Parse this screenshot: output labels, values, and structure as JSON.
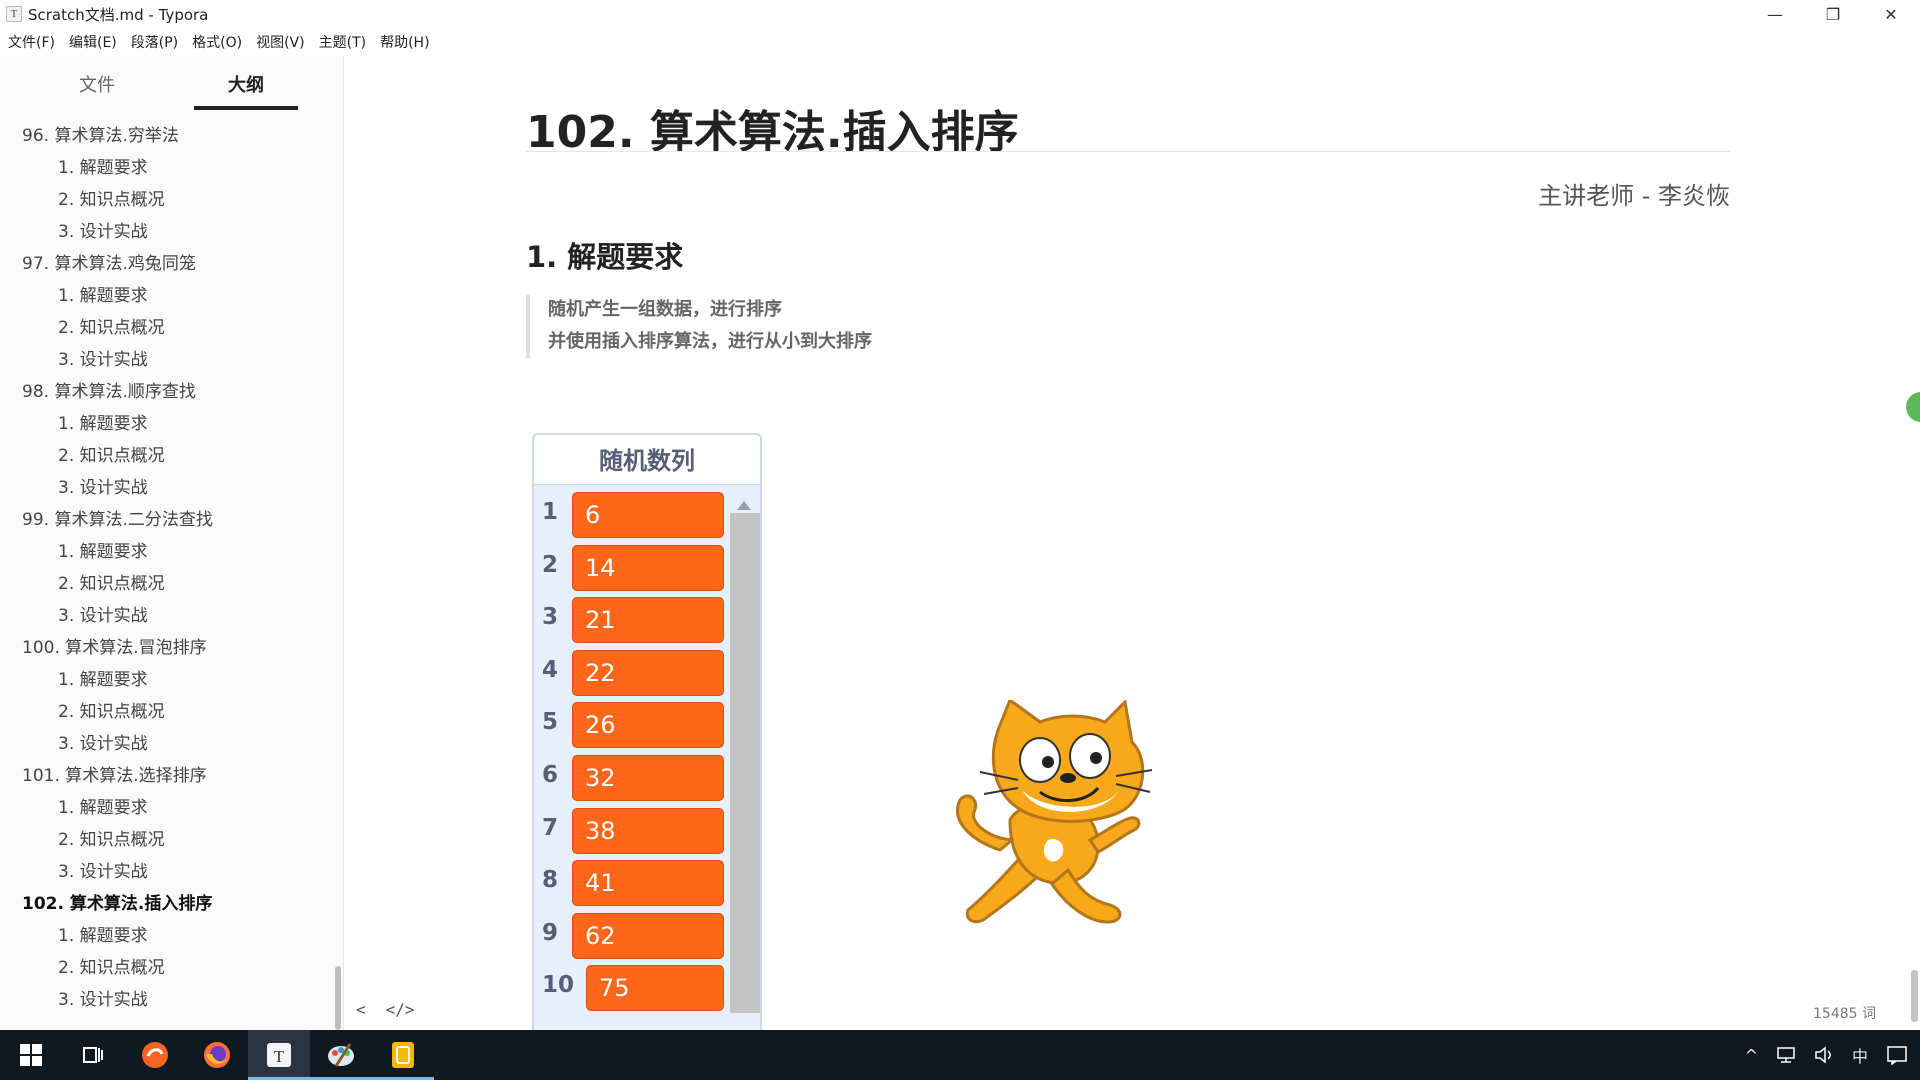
{
  "window": {
    "title": "Scratch文档.md - Typora",
    "app_icon": "T",
    "minimize_glyph": "—",
    "maximize_glyph": "❐",
    "close_glyph": "✕"
  },
  "menu": [
    "文件(F)",
    "编辑(E)",
    "段落(P)",
    "格式(O)",
    "视图(V)",
    "主题(T)",
    "帮助(H)"
  ],
  "sidebar": {
    "tabs": [
      "文件",
      "大纲"
    ],
    "active_tab": "大纲",
    "outline": [
      {
        "text": "96. 算术算法.穷举法",
        "level": 1
      },
      {
        "text": "1. 解题要求",
        "level": 2
      },
      {
        "text": "2. 知识点概况",
        "level": 2
      },
      {
        "text": "3. 设计实战",
        "level": 2
      },
      {
        "text": "97. 算术算法.鸡兔同笼",
        "level": 1
      },
      {
        "text": "1. 解题要求",
        "level": 2
      },
      {
        "text": "2. 知识点概况",
        "level": 2
      },
      {
        "text": "3. 设计实战",
        "level": 2
      },
      {
        "text": "98. 算术算法.顺序查找",
        "level": 1
      },
      {
        "text": "1. 解题要求",
        "level": 2
      },
      {
        "text": "2. 知识点概况",
        "level": 2
      },
      {
        "text": "3. 设计实战",
        "level": 2
      },
      {
        "text": "99. 算术算法.二分法查找",
        "level": 1
      },
      {
        "text": "1. 解题要求",
        "level": 2
      },
      {
        "text": "2. 知识点概况",
        "level": 2
      },
      {
        "text": "3. 设计实战",
        "level": 2
      },
      {
        "text": "100. 算术算法.冒泡排序",
        "level": 1
      },
      {
        "text": "1. 解题要求",
        "level": 2
      },
      {
        "text": "2. 知识点概况",
        "level": 2
      },
      {
        "text": "3. 设计实战",
        "level": 2
      },
      {
        "text": "101. 算术算法.选择排序",
        "level": 1
      },
      {
        "text": "1. 解题要求",
        "level": 2
      },
      {
        "text": "2. 知识点概况",
        "level": 2
      },
      {
        "text": "3. 设计实战",
        "level": 2
      },
      {
        "text": "102. 算术算法.插入排序",
        "level": 1,
        "active": true
      },
      {
        "text": "1. 解题要求",
        "level": 2
      },
      {
        "text": "2. 知识点概况",
        "level": 2
      },
      {
        "text": "3. 设计实战",
        "level": 2
      }
    ]
  },
  "document": {
    "heading1": "102. 算术算法.插入排序",
    "teacher": "主讲老师 - 李炎恢",
    "heading2": "1. 解题要求",
    "blockquote": [
      "随机产生一组数据，进行排序",
      "并使用插入排序算法，进行从小到大排序"
    ]
  },
  "scratch_list": {
    "title": "随机数列",
    "items": [
      {
        "index": "1",
        "value": "6"
      },
      {
        "index": "2",
        "value": "14"
      },
      {
        "index": "3",
        "value": "21"
      },
      {
        "index": "4",
        "value": "22"
      },
      {
        "index": "5",
        "value": "26"
      },
      {
        "index": "6",
        "value": "32"
      },
      {
        "index": "7",
        "value": "38"
      },
      {
        "index": "8",
        "value": "41"
      },
      {
        "index": "9",
        "value": "62"
      },
      {
        "index": "10",
        "value": "75"
      }
    ],
    "cell_color": "#ff661a",
    "monitor_bg": "#e6f0fb"
  },
  "status": {
    "prev_glyph": "<",
    "source_glyph": "</>",
    "word_count": "15485 词"
  },
  "taskbar": {
    "apps": [
      "start-icon",
      "task-view-icon",
      "app-orange-icon",
      "firefox-icon",
      "typora-icon",
      "paint-icon",
      "app-yellow-icon"
    ],
    "tray_ime": "中"
  },
  "colors": {
    "accent_green": "#5cb85c",
    "taskbar_bg": "#101820",
    "active_underline": "#76b9ed"
  }
}
